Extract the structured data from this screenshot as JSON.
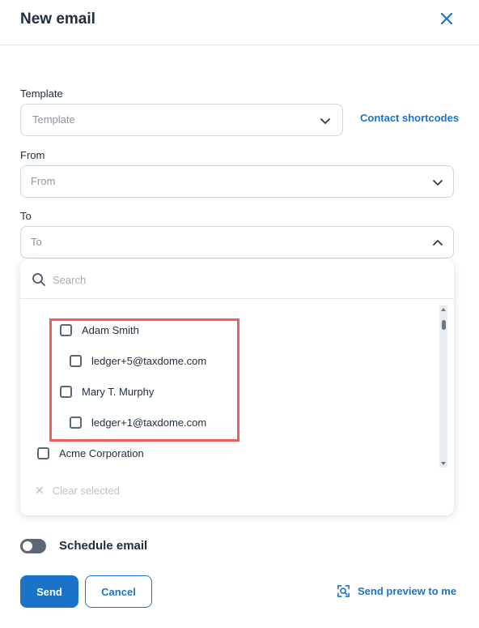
{
  "header": {
    "title": "New email"
  },
  "icons": {
    "close": "close-icon",
    "chevron": "chevron-down-icon",
    "search": "search-icon",
    "preview": "preview-icon"
  },
  "colors": {
    "accent": "#1a73c9",
    "highlight": "#ec5f5f",
    "toggle_off": "#5c6876"
  },
  "form": {
    "template": {
      "label": "Template",
      "placeholder": "Template"
    },
    "contact_shortcodes": "Contact shortcodes",
    "from": {
      "label": "From",
      "placeholder": "From"
    },
    "to": {
      "label": "To",
      "placeholder": "To"
    }
  },
  "dropdown": {
    "search_placeholder": "Search",
    "options": [
      {
        "label": "Adam Smith",
        "checked": false
      },
      {
        "label": "ledger+5@taxdome.com",
        "checked": false
      },
      {
        "label": "Mary T. Murphy",
        "checked": false
      },
      {
        "label": "ledger+1@taxdome.com",
        "checked": false
      },
      {
        "label": "Acme Corporation",
        "checked": false
      }
    ],
    "clear_selected": "Clear selected"
  },
  "schedule": {
    "label": "Schedule email",
    "enabled": false
  },
  "actions": {
    "send": "Send",
    "cancel": "Cancel",
    "preview": "Send preview to me"
  }
}
